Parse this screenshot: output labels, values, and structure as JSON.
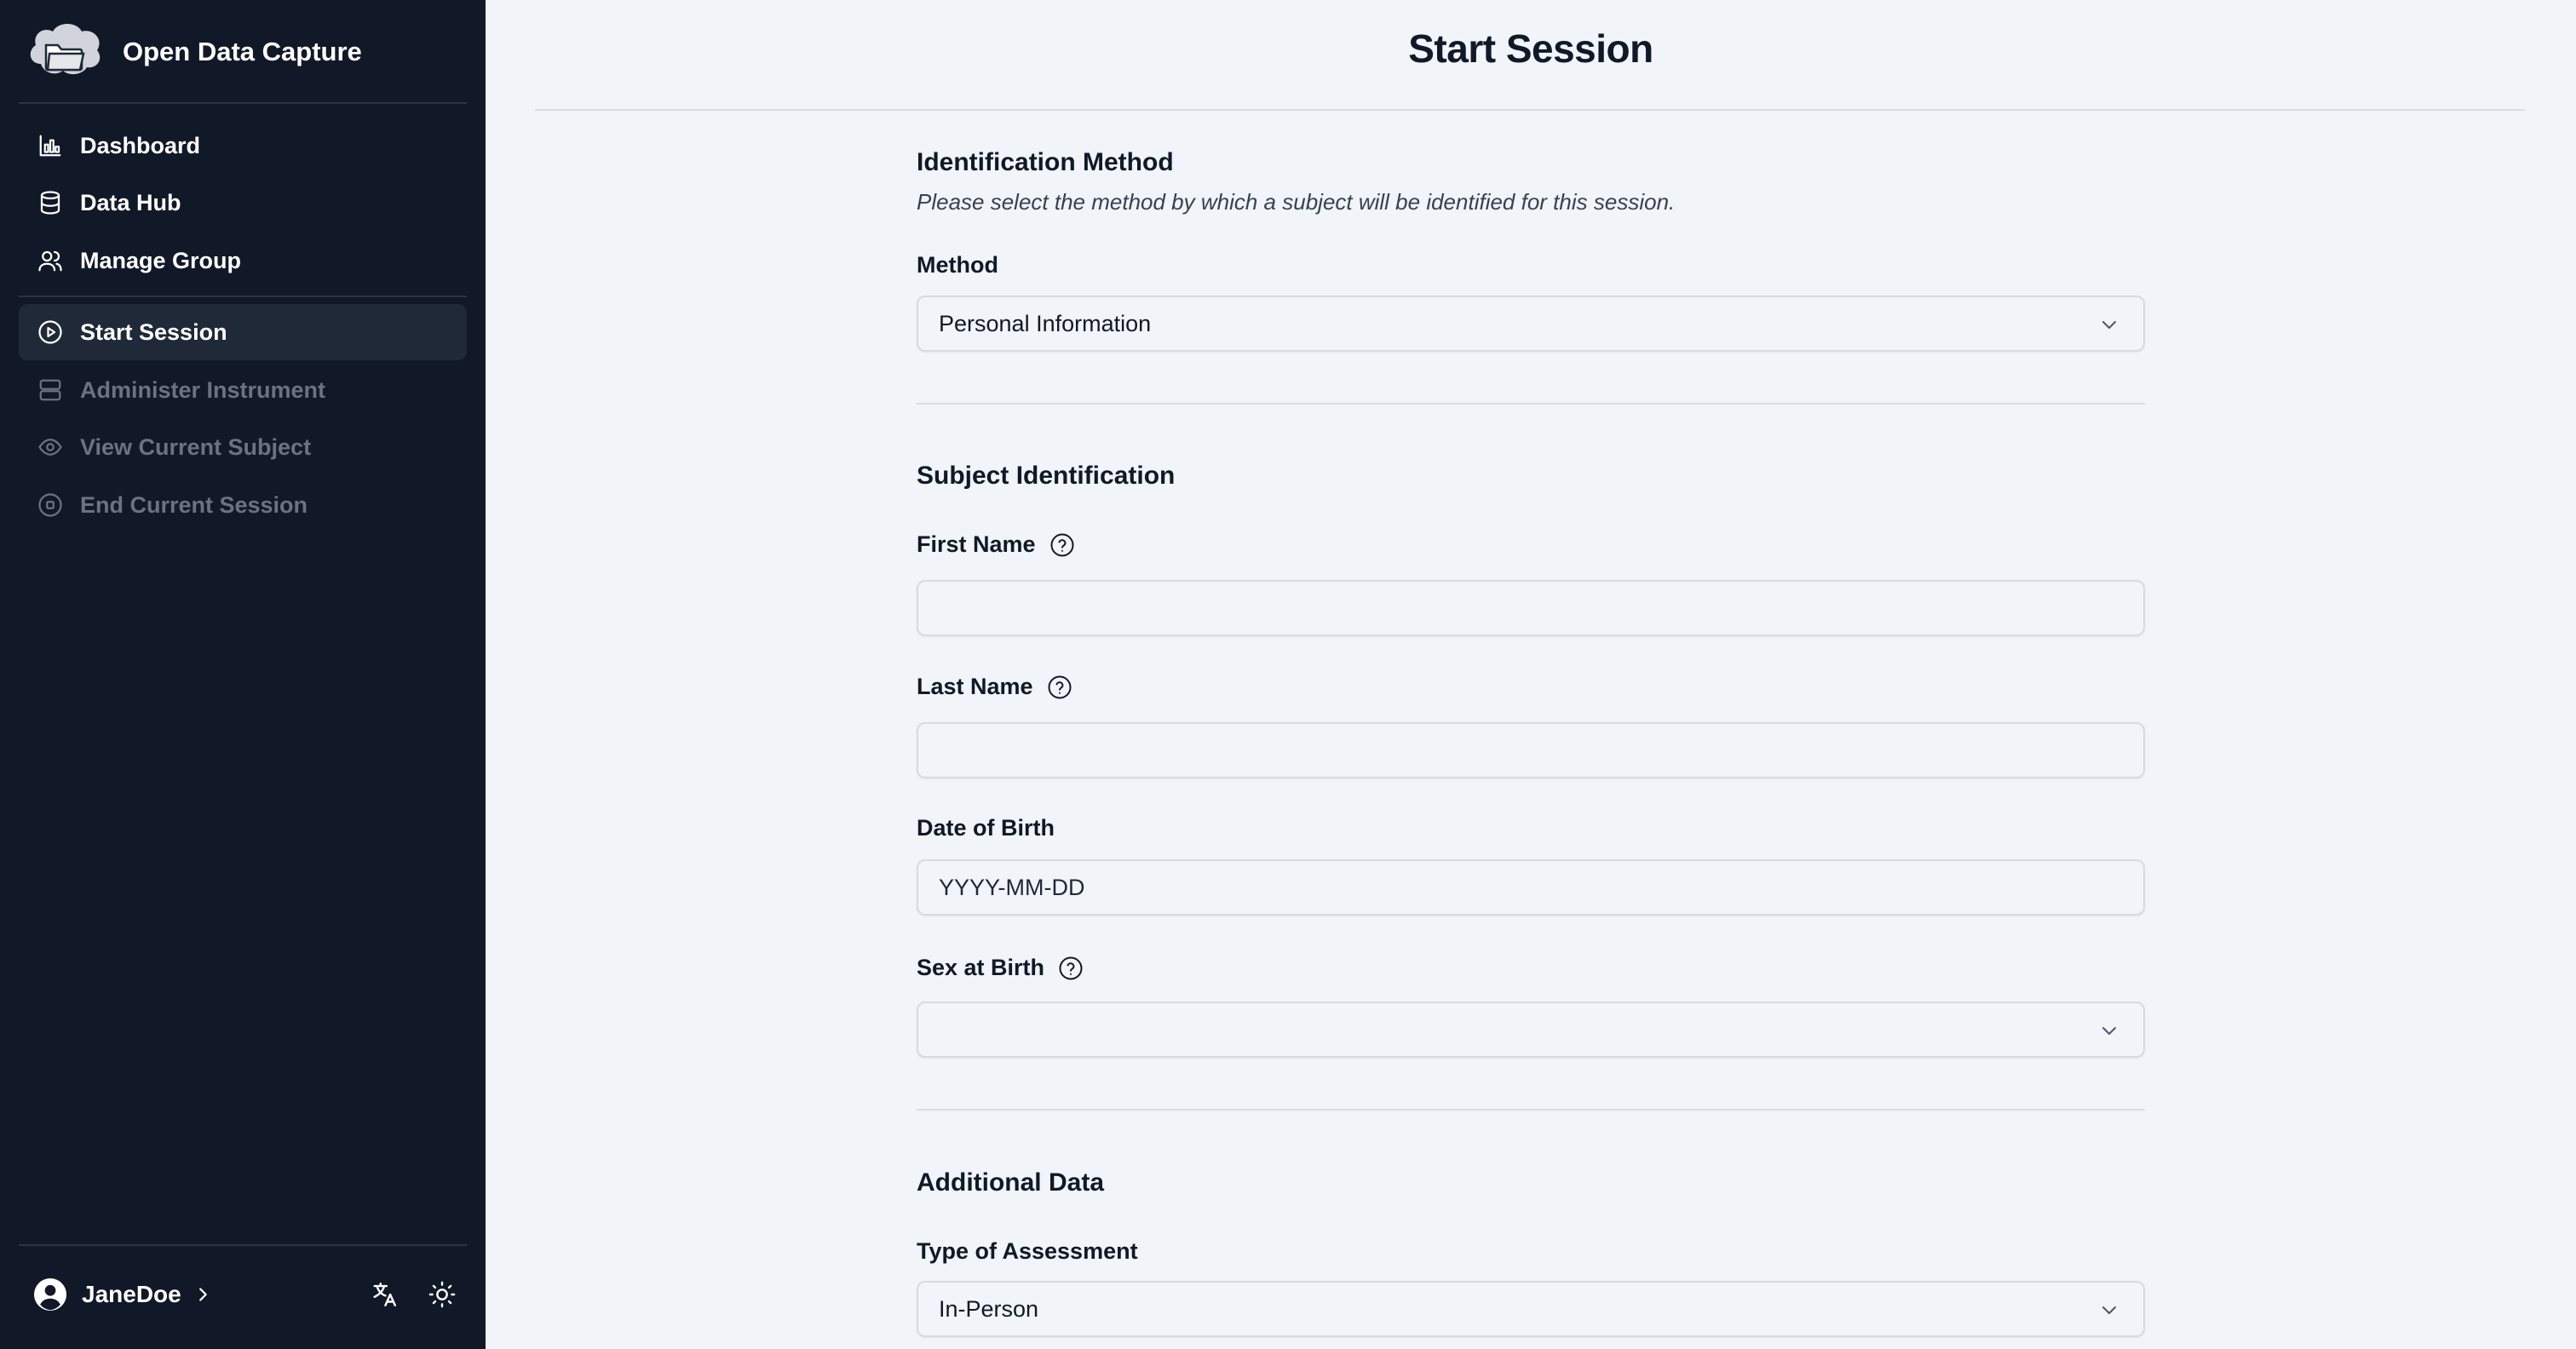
{
  "app": {
    "name": "Open Data Capture"
  },
  "sidebar": {
    "items": [
      {
        "label": "Dashboard",
        "icon": "bar-chart-icon",
        "state": "enabled"
      },
      {
        "label": "Data Hub",
        "icon": "database-icon",
        "state": "enabled"
      },
      {
        "label": "Manage Group",
        "icon": "users-icon",
        "state": "enabled"
      },
      {
        "label": "Start Session",
        "icon": "play-circle-icon",
        "state": "active"
      },
      {
        "label": "Administer Instrument",
        "icon": "server-icon",
        "state": "disabled"
      },
      {
        "label": "View Current Subject",
        "icon": "eye-icon",
        "state": "disabled"
      },
      {
        "label": "End Current Session",
        "icon": "stop-circle-icon",
        "state": "disabled"
      }
    ],
    "user": {
      "name": "JaneDoe"
    },
    "tools": {
      "language_icon": "translate-icon",
      "theme_icon": "sun-icon"
    }
  },
  "main": {
    "title": "Start Session",
    "identification": {
      "title": "Identification Method",
      "description": "Please select the method by which a subject will be identified for this session.",
      "method_label": "Method",
      "method_value": "Personal Information"
    },
    "subject": {
      "title": "Subject Identification",
      "first_name_label": "First Name",
      "first_name_value": "",
      "last_name_label": "Last Name",
      "last_name_value": "",
      "dob_label": "Date of Birth",
      "dob_placeholder": "YYYY-MM-DD",
      "sex_label": "Sex at Birth",
      "sex_value": ""
    },
    "additional": {
      "title": "Additional Data",
      "assessment_label": "Type of Assessment",
      "assessment_value": "In-Person"
    }
  },
  "colors": {
    "sidebar_bg": "#111827",
    "sidebar_active": "#1f2937",
    "page_bg": "#f1f4f8",
    "disabled_text": "#6b7280"
  }
}
